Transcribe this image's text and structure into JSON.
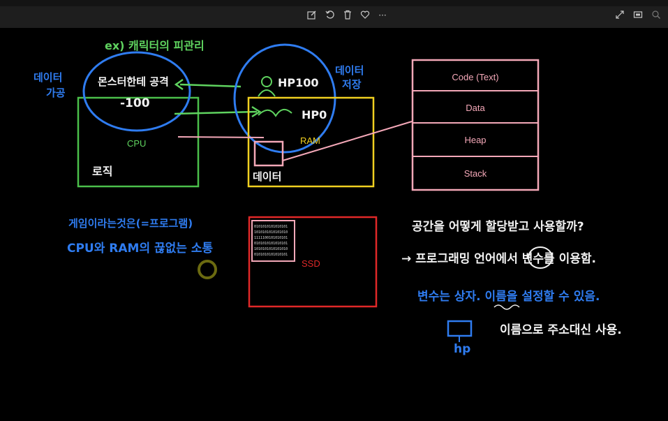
{
  "toolbar": {
    "center_icons": [
      "edit-icon",
      "rotate-icon",
      "delete-icon",
      "favorite-icon",
      "more-icon"
    ],
    "right_icons": [
      "expand-icon",
      "fit-icon",
      "zoom-icon"
    ],
    "more_label": "···"
  },
  "drawing": {
    "title": "ex) 캐릭터의 피관리",
    "left_label": "데이터\n가공",
    "right_label": "데이터\n저장",
    "oval_left_text": "몬스터한테 공격",
    "oval_left_value": "-100",
    "oval_right_hp": "HP100",
    "oval_right_hp0": "HP0",
    "cpu_label": "CPU",
    "logic_label": "로직",
    "ram_label": "RAM",
    "data_label": "데이터",
    "ssd_label": "SSD",
    "memory_segments": [
      "Code (Text)",
      "Data",
      "Heap",
      "Stack"
    ],
    "program_line1": "게임이라는것은(=프로그램)",
    "program_line2": "CPU와 RAM의 끊없는 소통",
    "question": "공간을 어떻게 할당받고 사용할까?",
    "answer": "→ 프로그래밍 언어에서 변수를 이용함.",
    "variable_note": "변수는 상자. 이름을 설정할 수 있음.",
    "name_note": "이름으로 주소대신 사용.",
    "box_label": "hp",
    "binary_rows": [
      "0101010101010101",
      "1010101010101010",
      "1111100101010101",
      "0101010101010101",
      "1010101010101010",
      "0101010101010101"
    ]
  },
  "colors": {
    "green": "#5fd35f",
    "blue": "#2f7cf0",
    "yellow": "#f0d020",
    "pink": "#f4a8b8",
    "red": "#e02828",
    "white": "#f2f2f2"
  }
}
